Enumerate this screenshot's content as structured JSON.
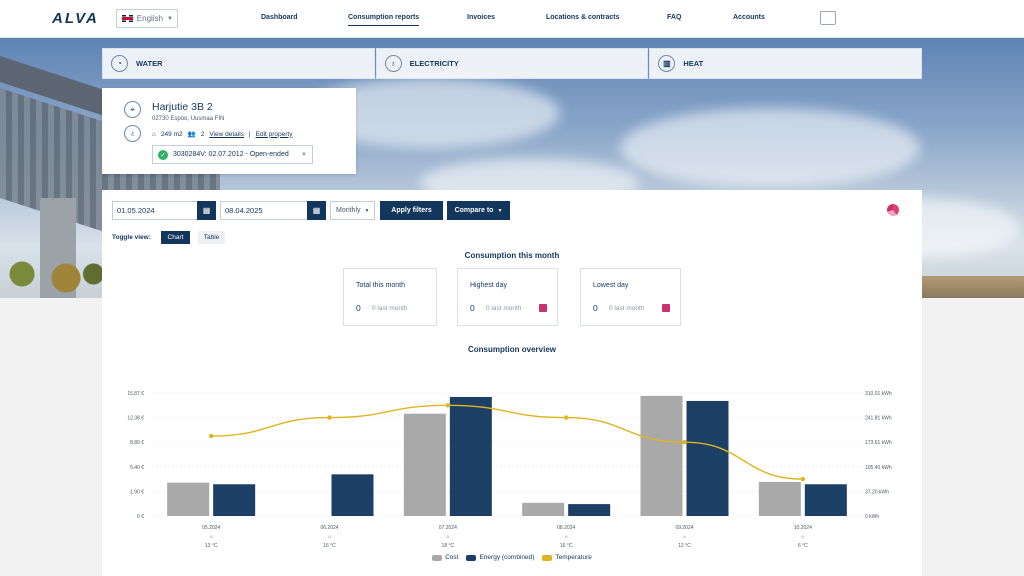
{
  "header": {
    "logo": "ALVA",
    "language": "English",
    "nav": [
      "Dashboard",
      "Consumption reports",
      "Invoices",
      "Locations & contracts",
      "FAQ",
      "Accounts"
    ],
    "active_nav": "Consumption reports"
  },
  "utility_tabs": [
    {
      "label": "WATER",
      "icon": "water-meter-icon"
    },
    {
      "label": "ELECTRICITY",
      "icon": "lightbulb-icon"
    },
    {
      "label": "HEAT",
      "icon": "radiator-icon"
    }
  ],
  "property": {
    "title": "Harjutie 3B 2",
    "address": "02730 Espoo, Uusmaa FIN",
    "area": "249 m2",
    "residents": "2",
    "view_details": "View details",
    "separator": "|",
    "edit_property": "Edit property",
    "contract": "3030284V: 02.07.2012 - Open-ended"
  },
  "filters": {
    "start_date": "01.05.2024",
    "end_date": "08.04.2025",
    "period": "Monthly",
    "apply_label": "Apply filters",
    "compare_label": "Compare to"
  },
  "toggle": {
    "label": "Toggle view:",
    "chart": "Chart",
    "table": "Table"
  },
  "month_summary": {
    "title": "Consumption this month",
    "cards": [
      {
        "title": "Total this month",
        "value": "0",
        "sub": "0 last month",
        "badge": false
      },
      {
        "title": "Highest day",
        "value": "0",
        "sub": "0 last month",
        "badge": true
      },
      {
        "title": "Lowest day",
        "value": "0",
        "sub": "0 last month",
        "badge": true
      }
    ]
  },
  "colors": {
    "primary": "#13375c",
    "cost": "#a9a9a9",
    "energy": "#1c3f66",
    "temperature": "#e0b41f",
    "badge": "#c8336f"
  },
  "chart_data": {
    "type": "bar",
    "title": "Consumption overview",
    "categories": [
      "05.2024",
      "06.2024",
      "07.2024",
      "08.2024",
      "09.2024",
      "10.2024"
    ],
    "temperature_labels": [
      "13 °C",
      "16 °C",
      "18 °C",
      "16 °C",
      "12 °C",
      "6 °C"
    ],
    "weather_icon": "sun-icon",
    "y_left_ticks": [
      "0 €",
      "1.90 €",
      "5.40 €",
      "8.89 €",
      "12.38 €",
      "15.87 €"
    ],
    "y_right_ticks": [
      "0 kWh",
      "37.20 kWh",
      "105.40 kWh",
      "173.61 kWh",
      "241.81 kWh",
      "310.01 kWh"
    ],
    "y_left_range": [
      0,
      15.87
    ],
    "y_right_range": [
      0,
      310.01
    ],
    "temperature_range": [
      0,
      20
    ],
    "series": [
      {
        "name": "Cost",
        "axis": "left",
        "values": [
          4.3,
          0,
          13.2,
          1.7,
          15.5,
          4.4
        ]
      },
      {
        "name": "Energy (combined)",
        "axis": "right",
        "values": [
          80,
          105,
          300,
          30,
          290,
          80
        ]
      },
      {
        "name": "Temperature",
        "axis": "temperature",
        "type": "line",
        "values": [
          13,
          16,
          18,
          16,
          12,
          6
        ]
      }
    ],
    "legend_position": "bottom",
    "grid": true
  }
}
